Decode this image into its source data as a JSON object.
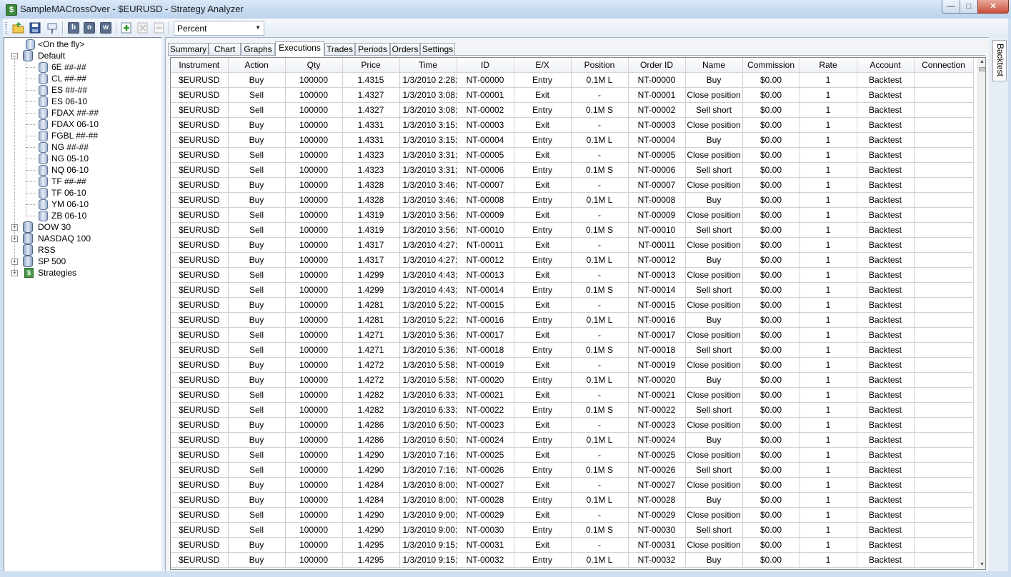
{
  "window": {
    "title": "SampleMACrossOver - $EURUSD - Strategy Analyzer",
    "icon": "dollar-app-icon",
    "buttons": [
      "minimize",
      "maximize",
      "close"
    ]
  },
  "toolbar": {
    "icons": [
      "open-folder-icon",
      "save-icon",
      "pin-icon",
      "b-icon",
      "o-icon",
      "w-icon",
      "add-icon",
      "remove-icon",
      "delete-icon"
    ],
    "letters": {
      "b": "b",
      "o": "o",
      "w": "w"
    },
    "display_combo": {
      "value": "Percent"
    }
  },
  "tree": {
    "on_the_fly": "<On the fly>",
    "default": {
      "label": "Default",
      "children": [
        "6E ##-##",
        "CL ##-##",
        "ES ##-##",
        "ES 06-10",
        "FDAX ##-##",
        "FDAX 06-10",
        "FGBL ##-##",
        "NG ##-##",
        "NG 05-10",
        "NQ 06-10",
        "TF ##-##",
        "TF 06-10",
        "YM 06-10",
        "ZB 06-10"
      ]
    },
    "groups": [
      "DOW 30",
      "NASDAQ 100",
      "RSS",
      "SP 500",
      "Strategies"
    ]
  },
  "tabs": [
    "Summary",
    "Chart",
    "Graphs",
    "Executions",
    "Trades",
    "Periods",
    "Orders",
    "Settings"
  ],
  "active_tab": "Executions",
  "side_tab": "Backtest",
  "grid": {
    "columns": [
      "Instrument",
      "Action",
      "Qty",
      "Price",
      "Time",
      "ID",
      "E/X",
      "Position",
      "Order ID",
      "Name",
      "Commission",
      "Rate",
      "Account",
      "Connection"
    ],
    "rows": [
      [
        "$EURUSD",
        "Buy",
        "100000",
        "1.4315",
        "1/3/2010 2:28:",
        "NT-00000",
        "Entry",
        "0.1M L",
        "NT-00000",
        "Buy",
        "$0.00",
        "1",
        "Backtest",
        ""
      ],
      [
        "$EURUSD",
        "Sell",
        "100000",
        "1.4327",
        "1/3/2010 3:08:",
        "NT-00001",
        "Exit",
        "-",
        "NT-00001",
        "Close position",
        "$0.00",
        "1",
        "Backtest",
        ""
      ],
      [
        "$EURUSD",
        "Sell",
        "100000",
        "1.4327",
        "1/3/2010 3:08:",
        "NT-00002",
        "Entry",
        "0.1M S",
        "NT-00002",
        "Sell short",
        "$0.00",
        "1",
        "Backtest",
        ""
      ],
      [
        "$EURUSD",
        "Buy",
        "100000",
        "1.4331",
        "1/3/2010 3:15:",
        "NT-00003",
        "Exit",
        "-",
        "NT-00003",
        "Close position",
        "$0.00",
        "1",
        "Backtest",
        ""
      ],
      [
        "$EURUSD",
        "Buy",
        "100000",
        "1.4331",
        "1/3/2010 3:15:",
        "NT-00004",
        "Entry",
        "0.1M L",
        "NT-00004",
        "Buy",
        "$0.00",
        "1",
        "Backtest",
        ""
      ],
      [
        "$EURUSD",
        "Sell",
        "100000",
        "1.4323",
        "1/3/2010 3:31:",
        "NT-00005",
        "Exit",
        "-",
        "NT-00005",
        "Close position",
        "$0.00",
        "1",
        "Backtest",
        ""
      ],
      [
        "$EURUSD",
        "Sell",
        "100000",
        "1.4323",
        "1/3/2010 3:31:",
        "NT-00006",
        "Entry",
        "0.1M S",
        "NT-00006",
        "Sell short",
        "$0.00",
        "1",
        "Backtest",
        ""
      ],
      [
        "$EURUSD",
        "Buy",
        "100000",
        "1.4328",
        "1/3/2010 3:46:",
        "NT-00007",
        "Exit",
        "-",
        "NT-00007",
        "Close position",
        "$0.00",
        "1",
        "Backtest",
        ""
      ],
      [
        "$EURUSD",
        "Buy",
        "100000",
        "1.4328",
        "1/3/2010 3:46:",
        "NT-00008",
        "Entry",
        "0.1M L",
        "NT-00008",
        "Buy",
        "$0.00",
        "1",
        "Backtest",
        ""
      ],
      [
        "$EURUSD",
        "Sell",
        "100000",
        "1.4319",
        "1/3/2010 3:56:",
        "NT-00009",
        "Exit",
        "-",
        "NT-00009",
        "Close position",
        "$0.00",
        "1",
        "Backtest",
        ""
      ],
      [
        "$EURUSD",
        "Sell",
        "100000",
        "1.4319",
        "1/3/2010 3:56:",
        "NT-00010",
        "Entry",
        "0.1M S",
        "NT-00010",
        "Sell short",
        "$0.00",
        "1",
        "Backtest",
        ""
      ],
      [
        "$EURUSD",
        "Buy",
        "100000",
        "1.4317",
        "1/3/2010 4:27:",
        "NT-00011",
        "Exit",
        "-",
        "NT-00011",
        "Close position",
        "$0.00",
        "1",
        "Backtest",
        ""
      ],
      [
        "$EURUSD",
        "Buy",
        "100000",
        "1.4317",
        "1/3/2010 4:27:",
        "NT-00012",
        "Entry",
        "0.1M L",
        "NT-00012",
        "Buy",
        "$0.00",
        "1",
        "Backtest",
        ""
      ],
      [
        "$EURUSD",
        "Sell",
        "100000",
        "1.4299",
        "1/3/2010 4:43:",
        "NT-00013",
        "Exit",
        "-",
        "NT-00013",
        "Close position",
        "$0.00",
        "1",
        "Backtest",
        ""
      ],
      [
        "$EURUSD",
        "Sell",
        "100000",
        "1.4299",
        "1/3/2010 4:43:",
        "NT-00014",
        "Entry",
        "0.1M S",
        "NT-00014",
        "Sell short",
        "$0.00",
        "1",
        "Backtest",
        ""
      ],
      [
        "$EURUSD",
        "Buy",
        "100000",
        "1.4281",
        "1/3/2010 5:22:",
        "NT-00015",
        "Exit",
        "-",
        "NT-00015",
        "Close position",
        "$0.00",
        "1",
        "Backtest",
        ""
      ],
      [
        "$EURUSD",
        "Buy",
        "100000",
        "1.4281",
        "1/3/2010 5:22:",
        "NT-00016",
        "Entry",
        "0.1M L",
        "NT-00016",
        "Buy",
        "$0.00",
        "1",
        "Backtest",
        ""
      ],
      [
        "$EURUSD",
        "Sell",
        "100000",
        "1.4271",
        "1/3/2010 5:36:",
        "NT-00017",
        "Exit",
        "-",
        "NT-00017",
        "Close position",
        "$0.00",
        "1",
        "Backtest",
        ""
      ],
      [
        "$EURUSD",
        "Sell",
        "100000",
        "1.4271",
        "1/3/2010 5:36:",
        "NT-00018",
        "Entry",
        "0.1M S",
        "NT-00018",
        "Sell short",
        "$0.00",
        "1",
        "Backtest",
        ""
      ],
      [
        "$EURUSD",
        "Buy",
        "100000",
        "1.4272",
        "1/3/2010 5:58:",
        "NT-00019",
        "Exit",
        "-",
        "NT-00019",
        "Close position",
        "$0.00",
        "1",
        "Backtest",
        ""
      ],
      [
        "$EURUSD",
        "Buy",
        "100000",
        "1.4272",
        "1/3/2010 5:58:",
        "NT-00020",
        "Entry",
        "0.1M L",
        "NT-00020",
        "Buy",
        "$0.00",
        "1",
        "Backtest",
        ""
      ],
      [
        "$EURUSD",
        "Sell",
        "100000",
        "1.4282",
        "1/3/2010 6:33:",
        "NT-00021",
        "Exit",
        "-",
        "NT-00021",
        "Close position",
        "$0.00",
        "1",
        "Backtest",
        ""
      ],
      [
        "$EURUSD",
        "Sell",
        "100000",
        "1.4282",
        "1/3/2010 6:33:",
        "NT-00022",
        "Entry",
        "0.1M S",
        "NT-00022",
        "Sell short",
        "$0.00",
        "1",
        "Backtest",
        ""
      ],
      [
        "$EURUSD",
        "Buy",
        "100000",
        "1.4286",
        "1/3/2010 6:50:",
        "NT-00023",
        "Exit",
        "-",
        "NT-00023",
        "Close position",
        "$0.00",
        "1",
        "Backtest",
        ""
      ],
      [
        "$EURUSD",
        "Buy",
        "100000",
        "1.4286",
        "1/3/2010 6:50:",
        "NT-00024",
        "Entry",
        "0.1M L",
        "NT-00024",
        "Buy",
        "$0.00",
        "1",
        "Backtest",
        ""
      ],
      [
        "$EURUSD",
        "Sell",
        "100000",
        "1.4290",
        "1/3/2010 7:16:",
        "NT-00025",
        "Exit",
        "-",
        "NT-00025",
        "Close position",
        "$0.00",
        "1",
        "Backtest",
        ""
      ],
      [
        "$EURUSD",
        "Sell",
        "100000",
        "1.4290",
        "1/3/2010 7:16:",
        "NT-00026",
        "Entry",
        "0.1M S",
        "NT-00026",
        "Sell short",
        "$0.00",
        "1",
        "Backtest",
        ""
      ],
      [
        "$EURUSD",
        "Buy",
        "100000",
        "1.4284",
        "1/3/2010 8:00:",
        "NT-00027",
        "Exit",
        "-",
        "NT-00027",
        "Close position",
        "$0.00",
        "1",
        "Backtest",
        ""
      ],
      [
        "$EURUSD",
        "Buy",
        "100000",
        "1.4284",
        "1/3/2010 8:00:",
        "NT-00028",
        "Entry",
        "0.1M L",
        "NT-00028",
        "Buy",
        "$0.00",
        "1",
        "Backtest",
        ""
      ],
      [
        "$EURUSD",
        "Sell",
        "100000",
        "1.4290",
        "1/3/2010 9:00:",
        "NT-00029",
        "Exit",
        "-",
        "NT-00029",
        "Close position",
        "$0.00",
        "1",
        "Backtest",
        ""
      ],
      [
        "$EURUSD",
        "Sell",
        "100000",
        "1.4290",
        "1/3/2010 9:00:",
        "NT-00030",
        "Entry",
        "0.1M S",
        "NT-00030",
        "Sell short",
        "$0.00",
        "1",
        "Backtest",
        ""
      ],
      [
        "$EURUSD",
        "Buy",
        "100000",
        "1.4295",
        "1/3/2010 9:15:",
        "NT-00031",
        "Exit",
        "-",
        "NT-00031",
        "Close position",
        "$0.00",
        "1",
        "Backtest",
        ""
      ],
      [
        "$EURUSD",
        "Buy",
        "100000",
        "1.4295",
        "1/3/2010 9:15:",
        "NT-00032",
        "Entry",
        "0.1M L",
        "NT-00032",
        "Buy",
        "$0.00",
        "1",
        "Backtest",
        ""
      ]
    ]
  }
}
